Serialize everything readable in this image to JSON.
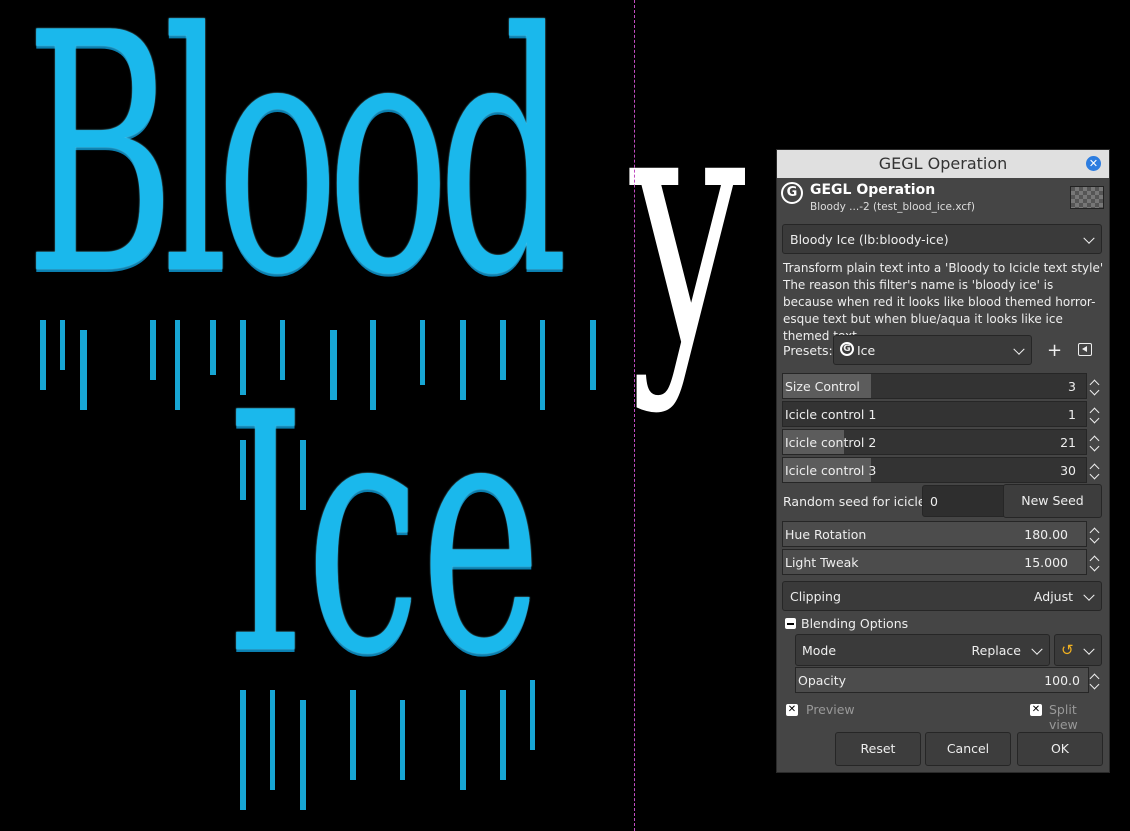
{
  "canvas": {
    "word1": "Blood",
    "word2": "Ice",
    "white_letter": "y"
  },
  "dialog": {
    "window_title": "GEGL Operation",
    "header_title": "GEGL Operation",
    "header_subtitle": "Bloody ...-2 (test_blood_ice.xcf)",
    "operation": "Bloody Ice (lb:bloody-ice)",
    "description": "Transform plain text into a 'Bloody to Icicle text style' The reason this filter's name is 'bloody ice' is because when red it looks like blood themed horror-esque text but when blue/aqua it looks like ice themed text.",
    "presets_label": "Presets:",
    "preset_value": "Ice",
    "sliders": [
      {
        "name": "Size Control",
        "value": "3",
        "fraction": 0.29
      },
      {
        "name": "Icicle control 1",
        "value": "1",
        "fraction": 0.0
      },
      {
        "name": "Icicle control 2",
        "value": "21",
        "fraction": 0.2
      },
      {
        "name": "Icicle control 3",
        "value": "30",
        "fraction": 0.29
      }
    ],
    "seed_label": "Random seed for icicles",
    "seed_value": "0",
    "new_seed_label": "New Seed",
    "hue": {
      "name": "Hue Rotation",
      "value": "180.00"
    },
    "light": {
      "name": "Light Tweak",
      "value": "15.000"
    },
    "clipping_label": "Clipping",
    "clipping_value": "Adjust",
    "blending_label": "Blending Options",
    "mode_label": "Mode",
    "mode_value": "Replace",
    "opacity": {
      "name": "Opacity",
      "value": "100.0"
    },
    "preview_label": "Preview",
    "split_label": "Split view",
    "reset_label": "Reset",
    "cancel_label": "Cancel",
    "ok_label": "OK"
  }
}
